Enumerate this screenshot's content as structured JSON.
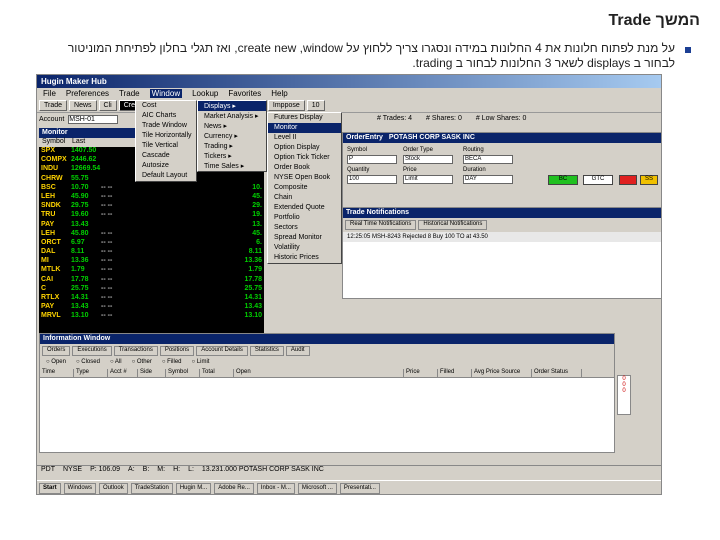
{
  "slide": {
    "title": "המשך Trade",
    "line1": "על מנת לפתוח חלונות את 4 החלונות במידה ונסגרו צריך ללחוץ על create new ,window, ואז תגלי בחלון לפתיחת המוניטור",
    "line2": "לבחור ב displays לשאר 3 החלונות לבחור ב trading."
  },
  "app": {
    "title": "Hugin Maker Hub",
    "menu": [
      "File",
      "Preferences",
      "Trade",
      "Window",
      "Lookup",
      "Favorites",
      "Help"
    ],
    "menu_active": "Window",
    "toolbar": [
      "Trade",
      "News",
      "Cli",
      "Create New",
      "Close",
      "Bracket",
      "Level 2",
      "Imppose",
      "10"
    ],
    "account_label": "Account",
    "account_value": "MSH-01",
    "stats": [
      "# Trades: 4",
      "# Shares: 0",
      "# Low Shares: 0"
    ]
  },
  "monitor": {
    "title": "Monitor",
    "columns": [
      "Symbol",
      "Last"
    ],
    "rows": [
      {
        "s": "SPX",
        "l": "1407.50",
        "d": "",
        "r": ""
      },
      {
        "s": "COMPX",
        "l": "2446.62",
        "d": "",
        "r": ""
      },
      {
        "s": "INDU",
        "l": "12669.54",
        "d": "",
        "r": ""
      },
      {
        "s": "CHRW",
        "l": "55.75",
        "d": "",
        "r": ""
      },
      {
        "s": "BSC",
        "l": "10.70",
        "d": "-- --",
        "r": "10."
      },
      {
        "s": "LEH",
        "l": "45.90",
        "d": "-- --",
        "r": "45."
      },
      {
        "s": "SNDK",
        "l": "29.75",
        "d": "-- --",
        "r": "29."
      },
      {
        "s": "TRU",
        "l": "19.60",
        "d": "-- --",
        "r": "19."
      },
      {
        "s": "PAY",
        "l": "13.43",
        "d": "",
        "r": "13."
      },
      {
        "s": "LEH",
        "l": "45.80",
        "d": "-- --",
        "r": "45."
      },
      {
        "s": "ORCT",
        "l": "6.97",
        "d": "-- --",
        "r": "6."
      },
      {
        "s": "DAL",
        "l": "8.11",
        "d": "-- --",
        "r": "8.11"
      },
      {
        "s": "MI",
        "l": "13.36",
        "d": "-- --",
        "r": "13.36"
      },
      {
        "s": "MTLK",
        "l": "1.79",
        "d": "-- --",
        "r": "1.79"
      },
      {
        "s": "CAI",
        "l": "17.78",
        "d": "-- --",
        "r": "17.78"
      },
      {
        "s": "C",
        "l": "25.75",
        "d": "-- --",
        "r": "25.75"
      },
      {
        "s": "RTLX",
        "l": "14.31",
        "d": "-- --",
        "r": "14.31"
      },
      {
        "s": "PAY",
        "l": "13.43",
        "d": "-- --",
        "r": "13.43"
      },
      {
        "s": "MRVL",
        "l": "13.10",
        "d": "-- --",
        "r": "13.10"
      }
    ]
  },
  "menus": {
    "create": [
      "Cost",
      "AIC Charts",
      "Trade Window",
      "Tile Horizontally",
      "Tile Vertical",
      "Cascade",
      "Autosize",
      "Default Layout"
    ],
    "sub": [
      "Displays",
      "Market Analysis",
      "News",
      "Currency",
      "Trading",
      "Tickers",
      "Time Sales"
    ],
    "displays": [
      "Futures Display",
      "Monitor",
      "Level II",
      "Option Display",
      "Option Tick Ticker",
      "Order Book",
      "NYSE Open Book",
      "Composite",
      "Chain",
      "Extended Quote",
      "Portfolio",
      "Sectors",
      "Spread Monitor",
      "Volatility",
      "Historic Prices"
    ],
    "displays_selected": "Monitor"
  },
  "order": {
    "title": "OrderEntry",
    "symbol_desc": "POTASH CORP SASK INC",
    "labels": [
      "Symbol",
      "Order Type",
      "Routing",
      "Quantity",
      "Price",
      "Duration"
    ],
    "values": [
      "P",
      "Stock",
      "BECA",
      "100",
      "Limit",
      "DAY"
    ],
    "buttons": [
      "BC",
      "GTC",
      "SS"
    ]
  },
  "notif": {
    "title": "Trade Notifications",
    "tabs": [
      "Real Time Notifications",
      "Historical Notifications"
    ],
    "line": "12:25:05 MSH-8243 Rejected 8 Buy 100 TO at 43.50"
  },
  "info": {
    "title": "Information Window",
    "tabs": [
      "Orders",
      "Executions",
      "Transactions",
      "Positions",
      "Account Details",
      "Statistics",
      "Audit"
    ],
    "radios": [
      "Open",
      "Closed",
      "All",
      "Other",
      "Filled",
      "Limit"
    ],
    "columns": [
      "Time",
      "Type",
      "Acct #",
      "Side",
      "Symbol",
      "Total",
      "Open",
      "Price",
      "Filled",
      "Avg Price Source",
      "Order Status"
    ]
  },
  "statusbar": [
    "PDT",
    "NYSE",
    "P: 106.09",
    "A:",
    "B:",
    "M:",
    "H:",
    "L:",
    "13.231.000 POTASH CORP SASK INC"
  ],
  "taskbar": [
    "Start",
    "Windows",
    "Outlook",
    "TradeStation",
    "Hugin M...",
    "Adobe Re...",
    "Inbox - M...",
    "Microsoft ...",
    "Presentati..."
  ]
}
